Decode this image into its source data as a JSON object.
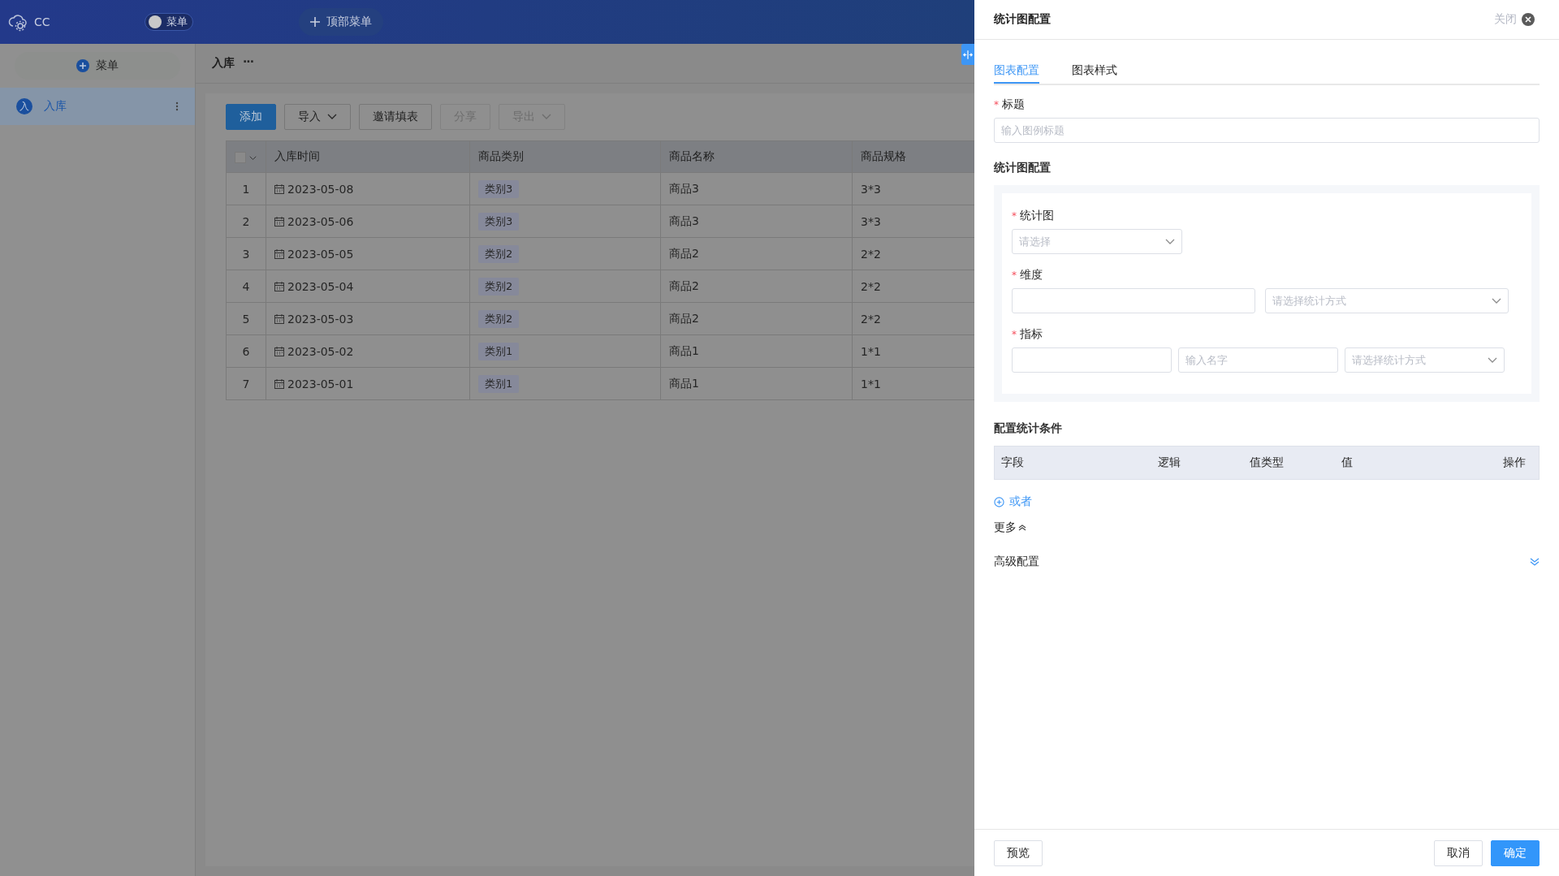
{
  "header": {
    "logo_text": "CC",
    "menu_toggle": {
      "label": "菜单",
      "on": false
    },
    "top_menu_button": "顶部菜单"
  },
  "sidebar": {
    "add_button": "菜单",
    "items": [
      {
        "badge": "入",
        "label": "入库",
        "selected": true
      }
    ]
  },
  "breadcrumb": {
    "title": "入库",
    "more": "···"
  },
  "toolbar": [
    {
      "label": "添加",
      "kind": "primary",
      "dropdown": false,
      "disabled": false
    },
    {
      "label": "导入",
      "kind": "default",
      "dropdown": true,
      "disabled": false
    },
    {
      "label": "邀请填表",
      "kind": "default",
      "dropdown": false,
      "disabled": false
    },
    {
      "label": "分享",
      "kind": "default",
      "dropdown": false,
      "disabled": true
    },
    {
      "label": "导出",
      "kind": "default",
      "dropdown": true,
      "disabled": true
    }
  ],
  "table": {
    "select_all": {
      "checked": false
    },
    "columns": [
      "入库时间",
      "商品类别",
      "商品名称",
      "商品规格"
    ],
    "rows": [
      {
        "index": "1",
        "date": "2023-05-08",
        "category": "类别3",
        "name": "商品3",
        "spec": "3*3"
      },
      {
        "index": "2",
        "date": "2023-05-06",
        "category": "类别3",
        "name": "商品3",
        "spec": "3*3"
      },
      {
        "index": "3",
        "date": "2023-05-05",
        "category": "类别2",
        "name": "商品2",
        "spec": "2*2"
      },
      {
        "index": "4",
        "date": "2023-05-04",
        "category": "类别2",
        "name": "商品2",
        "spec": "2*2"
      },
      {
        "index": "5",
        "date": "2023-05-03",
        "category": "类别2",
        "name": "商品2",
        "spec": "2*2"
      },
      {
        "index": "6",
        "date": "2023-05-02",
        "category": "类别1",
        "name": "商品1",
        "spec": "1*1"
      },
      {
        "index": "7",
        "date": "2023-05-01",
        "category": "类别1",
        "name": "商品1",
        "spec": "1*1"
      }
    ]
  },
  "drawer": {
    "title": "统计图配置",
    "close_label": "关闭",
    "tabs": [
      {
        "label": "图表配置",
        "selected": true
      },
      {
        "label": "图表样式",
        "selected": false
      }
    ],
    "title_field": {
      "required_mark": "*",
      "label": "标题",
      "placeholder": "输入图例标题"
    },
    "chart_section": {
      "heading": "统计图配置",
      "chart_type": {
        "required_mark": "*",
        "label": "统计图",
        "placeholder": "请选择"
      },
      "dimension": {
        "required_mark": "*",
        "label": "维度",
        "method_placeholder": "请选择统计方式"
      },
      "metric": {
        "required_mark": "*",
        "label": "指标",
        "name_placeholder": "输入名字",
        "method_placeholder": "请选择统计方式"
      }
    },
    "conditions": {
      "heading": "配置统计条件",
      "columns": [
        "字段",
        "逻辑",
        "值类型",
        "值",
        "操作"
      ],
      "add_or": "或者"
    },
    "more": "更多",
    "advanced": "高级配置",
    "footer": {
      "preview": "预览",
      "cancel": "取消",
      "confirm": "确定"
    }
  }
}
